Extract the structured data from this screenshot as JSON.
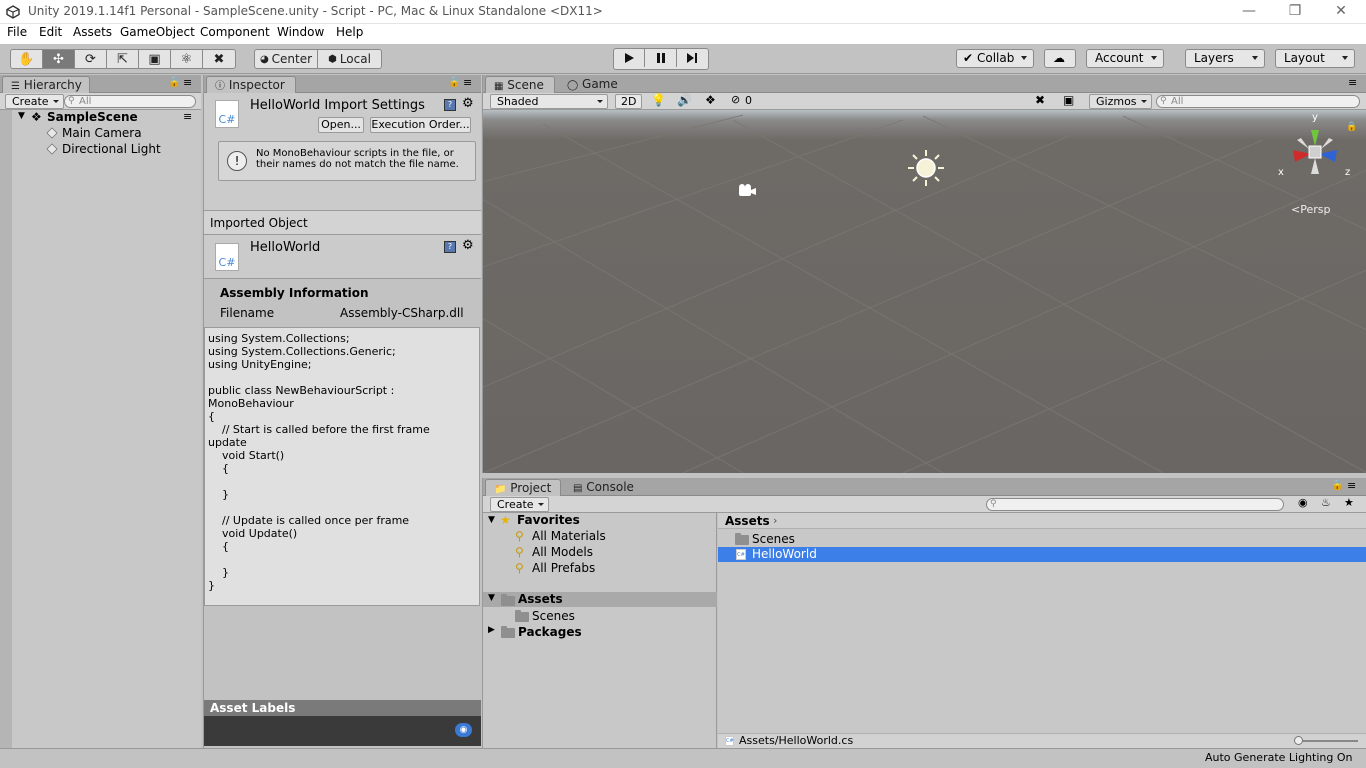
{
  "window": {
    "title": "Unity 2019.1.14f1 Personal - SampleScene.unity - Script - PC, Mac & Linux Standalone <DX11>"
  },
  "menu": [
    "File",
    "Edit",
    "Assets",
    "GameObject",
    "Component",
    "Window",
    "Help"
  ],
  "toolbar": {
    "pivot": "Center",
    "space": "Local",
    "collab": "Collab",
    "account": "Account",
    "layers": "Layers",
    "layout": "Layout"
  },
  "hierarchy": {
    "tab": "Hierarchy",
    "create": "Create",
    "search_placeholder": "All",
    "scene": "SampleScene",
    "items": [
      "Main Camera",
      "Directional Light"
    ]
  },
  "inspector": {
    "tab": "Inspector",
    "title": "HelloWorld Import Settings",
    "open": "Open...",
    "execution_order": "Execution Order...",
    "warning": "No MonoBehaviour scripts in the file, or their names do not match the file name.",
    "imported_object": "Imported Object",
    "object_name": "HelloWorld",
    "cs_label": "C#",
    "assembly_title": "Assembly Information",
    "filename_label": "Filename",
    "filename_value": "Assembly-CSharp.dll",
    "code": "using System.Collections;\nusing System.Collections.Generic;\nusing UnityEngine;\n\npublic class NewBehaviourScript :\nMonoBehaviour\n{\n    // Start is called before the first frame\nupdate\n    void Start()\n    {\n\n    }\n\n    // Update is called once per frame\n    void Update()\n    {\n\n    }\n}",
    "asset_labels": "Asset Labels"
  },
  "scene": {
    "tab_scene": "Scene",
    "tab_game": "Game",
    "shading": "Shaded",
    "mode2d": "2D",
    "fx_count": "0",
    "gizmos": "Gizmos",
    "search_placeholder": "All",
    "axis_y": "y",
    "axis_x": "x",
    "axis_z": "z",
    "persp": "Persp"
  },
  "project": {
    "tab_project": "Project",
    "tab_console": "Console",
    "create": "Create",
    "favorites": "Favorites",
    "fav_items": [
      "All Materials",
      "All Models",
      "All Prefabs"
    ],
    "assets": "Assets",
    "asset_children": [
      "Scenes"
    ],
    "packages": "Packages",
    "breadcrumb": "Assets",
    "files": [
      "Scenes",
      "HelloWorld"
    ],
    "selected_path": "Assets/HelloWorld.cs"
  },
  "status": {
    "right": "Auto Generate Lighting On"
  },
  "colors": {
    "selection": "#3d7fe8",
    "scene_bg": "#6e6a66",
    "sky": "#b7c0c4"
  }
}
